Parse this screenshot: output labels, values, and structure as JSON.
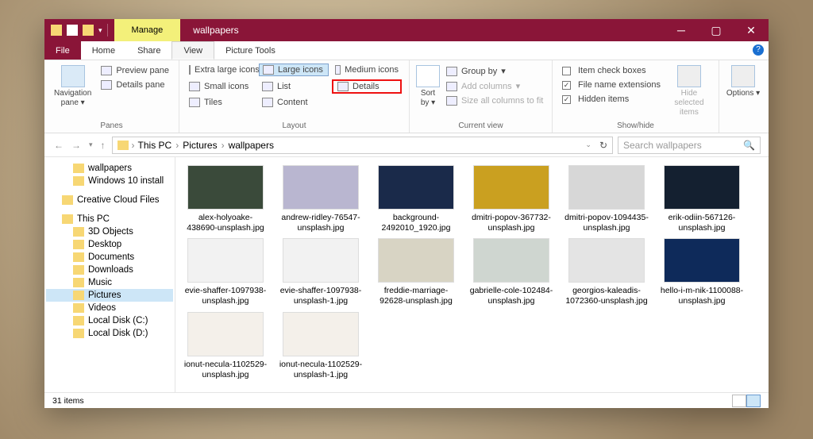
{
  "titlebar": {
    "context_tab": "Manage",
    "title": "wallpapers"
  },
  "tabs": {
    "file": "File",
    "list": [
      "Home",
      "Share",
      "View",
      "Picture Tools"
    ],
    "active": "View"
  },
  "ribbon": {
    "panes": {
      "label": "Panes",
      "nav": "Navigation pane",
      "preview": "Preview pane",
      "details": "Details pane"
    },
    "layout": {
      "label": "Layout",
      "opts": [
        "Extra large icons",
        "Large icons",
        "Medium icons",
        "Small icons",
        "List",
        "Details",
        "Tiles",
        "Content"
      ],
      "selected": "Large icons",
      "highlighted": "Details"
    },
    "current": {
      "label": "Current view",
      "sort": "Sort by",
      "group": "Group by",
      "addcols": "Add columns",
      "sizecols": "Size all columns to fit"
    },
    "showhide": {
      "label": "Show/hide",
      "checks": [
        "Item check boxes",
        "File name extensions",
        "Hidden items"
      ],
      "checked": [
        false,
        true,
        true
      ],
      "hidesel": "Hide selected items"
    },
    "options": "Options"
  },
  "address": {
    "crumbs": [
      "This PC",
      "Pictures",
      "wallpapers"
    ],
    "search_placeholder": "Search wallpapers"
  },
  "tree": [
    {
      "label": "wallpapers",
      "indent": 2,
      "icon": "folder"
    },
    {
      "label": "Windows 10 install",
      "indent": 2,
      "icon": "folder"
    },
    {
      "label": "",
      "indent": 0,
      "spacer": true
    },
    {
      "label": "Creative Cloud Files",
      "indent": 1,
      "icon": "cc"
    },
    {
      "label": "",
      "indent": 0,
      "spacer": true
    },
    {
      "label": "This PC",
      "indent": 1,
      "icon": "pc"
    },
    {
      "label": "3D Objects",
      "indent": 2,
      "icon": "obj"
    },
    {
      "label": "Desktop",
      "indent": 2,
      "icon": "desktop"
    },
    {
      "label": "Documents",
      "indent": 2,
      "icon": "docs"
    },
    {
      "label": "Downloads",
      "indent": 2,
      "icon": "down"
    },
    {
      "label": "Music",
      "indent": 2,
      "icon": "music"
    },
    {
      "label": "Pictures",
      "indent": 2,
      "icon": "pics",
      "selected": true
    },
    {
      "label": "Videos",
      "indent": 2,
      "icon": "vid"
    },
    {
      "label": "Local Disk (C:)",
      "indent": 2,
      "icon": "disk"
    },
    {
      "label": "Local Disk (D:)",
      "indent": 2,
      "icon": "disk"
    }
  ],
  "files": [
    {
      "name": "alex-holyoake-438690-unsplash.jpg",
      "color": "#3a4a3a"
    },
    {
      "name": "andrew-ridley-76547-unsplash.jpg",
      "color": "#b9b6d0"
    },
    {
      "name": "background-2492010_1920.jpg",
      "color": "#1a2a4a"
    },
    {
      "name": "dmitri-popov-367732-unsplash.jpg",
      "color": "#caa020"
    },
    {
      "name": "dmitri-popov-1094435-unsplash.jpg",
      "color": "#d7d7d7"
    },
    {
      "name": "erik-odiin-567126-unsplash.jpg",
      "color": "#142030"
    },
    {
      "name": "evie-shaffer-1097938-unsplash.jpg",
      "color": "#f2f2f2"
    },
    {
      "name": "evie-shaffer-1097938-unsplash-1.jpg",
      "color": "#f2f2f2"
    },
    {
      "name": "freddie-marriage-92628-unsplash.jpg",
      "color": "#d8d4c4"
    },
    {
      "name": "gabrielle-cole-102484-unsplash.jpg",
      "color": "#cfd6d0"
    },
    {
      "name": "georgios-kaleadis-1072360-unsplash.jpg",
      "color": "#e4e4e4"
    },
    {
      "name": "hello-i-m-nik-1100088-unsplash.jpg",
      "color": "#0e2a5a"
    },
    {
      "name": "ionut-necula-1102529-unsplash.jpg",
      "color": "#f4f0ea"
    },
    {
      "name": "ionut-necula-1102529-unsplash-1.jpg",
      "color": "#f4f0ea"
    }
  ],
  "status": {
    "count": "31 items"
  }
}
